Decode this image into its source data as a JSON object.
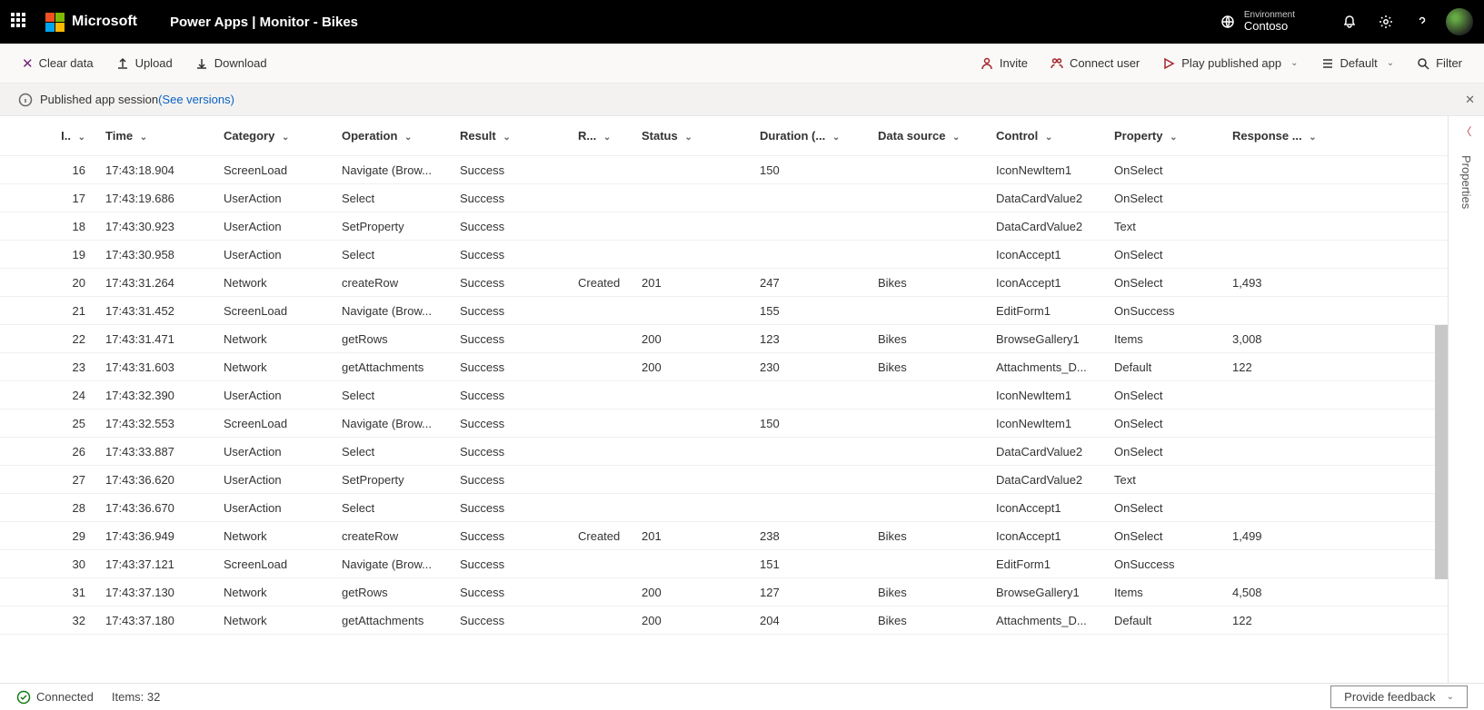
{
  "topbar": {
    "brand": "Microsoft",
    "breadcrumb": "Power Apps  |  Monitor - Bikes",
    "env_label": "Environment",
    "env_name": "Contoso"
  },
  "cmdbar": {
    "clear": "Clear data",
    "upload": "Upload",
    "download": "Download",
    "invite": "Invite",
    "connect": "Connect user",
    "play": "Play published app",
    "default": "Default",
    "filter": "Filter"
  },
  "infobar": {
    "text": "Published app session ",
    "link": "(See versions)"
  },
  "columns": {
    "id": "I..",
    "time": "Time",
    "category": "Category",
    "operation": "Operation",
    "result": "Result",
    "rx": "R...",
    "status": "Status",
    "duration": "Duration (...",
    "datasource": "Data source",
    "control": "Control",
    "property": "Property",
    "response": "Response ..."
  },
  "rows": [
    {
      "id": "16",
      "time": "17:43:18.904",
      "cat": "ScreenLoad",
      "op": "Navigate (Brow...",
      "res": "Success",
      "rx": "",
      "status": "",
      "dur": "150",
      "ds": "",
      "ctrl": "IconNewItem1",
      "prop": "OnSelect",
      "resp": ""
    },
    {
      "id": "17",
      "time": "17:43:19.686",
      "cat": "UserAction",
      "op": "Select",
      "res": "Success",
      "rx": "",
      "status": "",
      "dur": "",
      "ds": "",
      "ctrl": "DataCardValue2",
      "prop": "OnSelect",
      "resp": ""
    },
    {
      "id": "18",
      "time": "17:43:30.923",
      "cat": "UserAction",
      "op": "SetProperty",
      "res": "Success",
      "rx": "",
      "status": "",
      "dur": "",
      "ds": "",
      "ctrl": "DataCardValue2",
      "prop": "Text",
      "resp": ""
    },
    {
      "id": "19",
      "time": "17:43:30.958",
      "cat": "UserAction",
      "op": "Select",
      "res": "Success",
      "rx": "",
      "status": "",
      "dur": "",
      "ds": "",
      "ctrl": "IconAccept1",
      "prop": "OnSelect",
      "resp": ""
    },
    {
      "id": "20",
      "time": "17:43:31.264",
      "cat": "Network",
      "op": "createRow",
      "res": "Success",
      "rx": "Created",
      "status": "201",
      "dur": "247",
      "ds": "Bikes",
      "ctrl": "IconAccept1",
      "prop": "OnSelect",
      "resp": "1,493"
    },
    {
      "id": "21",
      "time": "17:43:31.452",
      "cat": "ScreenLoad",
      "op": "Navigate (Brow...",
      "res": "Success",
      "rx": "",
      "status": "",
      "dur": "155",
      "ds": "",
      "ctrl": "EditForm1",
      "prop": "OnSuccess",
      "resp": ""
    },
    {
      "id": "22",
      "time": "17:43:31.471",
      "cat": "Network",
      "op": "getRows",
      "res": "Success",
      "rx": "",
      "status": "200",
      "dur": "123",
      "ds": "Bikes",
      "ctrl": "BrowseGallery1",
      "prop": "Items",
      "resp": "3,008"
    },
    {
      "id": "23",
      "time": "17:43:31.603",
      "cat": "Network",
      "op": "getAttachments",
      "res": "Success",
      "rx": "",
      "status": "200",
      "dur": "230",
      "ds": "Bikes",
      "ctrl": "Attachments_D...",
      "prop": "Default",
      "resp": "122"
    },
    {
      "id": "24",
      "time": "17:43:32.390",
      "cat": "UserAction",
      "op": "Select",
      "res": "Success",
      "rx": "",
      "status": "",
      "dur": "",
      "ds": "",
      "ctrl": "IconNewItem1",
      "prop": "OnSelect",
      "resp": ""
    },
    {
      "id": "25",
      "time": "17:43:32.553",
      "cat": "ScreenLoad",
      "op": "Navigate (Brow...",
      "res": "Success",
      "rx": "",
      "status": "",
      "dur": "150",
      "ds": "",
      "ctrl": "IconNewItem1",
      "prop": "OnSelect",
      "resp": ""
    },
    {
      "id": "26",
      "time": "17:43:33.887",
      "cat": "UserAction",
      "op": "Select",
      "res": "Success",
      "rx": "",
      "status": "",
      "dur": "",
      "ds": "",
      "ctrl": "DataCardValue2",
      "prop": "OnSelect",
      "resp": ""
    },
    {
      "id": "27",
      "time": "17:43:36.620",
      "cat": "UserAction",
      "op": "SetProperty",
      "res": "Success",
      "rx": "",
      "status": "",
      "dur": "",
      "ds": "",
      "ctrl": "DataCardValue2",
      "prop": "Text",
      "resp": ""
    },
    {
      "id": "28",
      "time": "17:43:36.670",
      "cat": "UserAction",
      "op": "Select",
      "res": "Success",
      "rx": "",
      "status": "",
      "dur": "",
      "ds": "",
      "ctrl": "IconAccept1",
      "prop": "OnSelect",
      "resp": ""
    },
    {
      "id": "29",
      "time": "17:43:36.949",
      "cat": "Network",
      "op": "createRow",
      "res": "Success",
      "rx": "Created",
      "status": "201",
      "dur": "238",
      "ds": "Bikes",
      "ctrl": "IconAccept1",
      "prop": "OnSelect",
      "resp": "1,499"
    },
    {
      "id": "30",
      "time": "17:43:37.121",
      "cat": "ScreenLoad",
      "op": "Navigate (Brow...",
      "res": "Success",
      "rx": "",
      "status": "",
      "dur": "151",
      "ds": "",
      "ctrl": "EditForm1",
      "prop": "OnSuccess",
      "resp": ""
    },
    {
      "id": "31",
      "time": "17:43:37.130",
      "cat": "Network",
      "op": "getRows",
      "res": "Success",
      "rx": "",
      "status": "200",
      "dur": "127",
      "ds": "Bikes",
      "ctrl": "BrowseGallery1",
      "prop": "Items",
      "resp": "4,508"
    },
    {
      "id": "32",
      "time": "17:43:37.180",
      "cat": "Network",
      "op": "getAttachments",
      "res": "Success",
      "rx": "",
      "status": "200",
      "dur": "204",
      "ds": "Bikes",
      "ctrl": "Attachments_D...",
      "prop": "Default",
      "resp": "122"
    }
  ],
  "properties_pane": {
    "label": "Properties"
  },
  "status": {
    "connected": "Connected",
    "items": "Items: 32",
    "feedback": "Provide feedback"
  }
}
